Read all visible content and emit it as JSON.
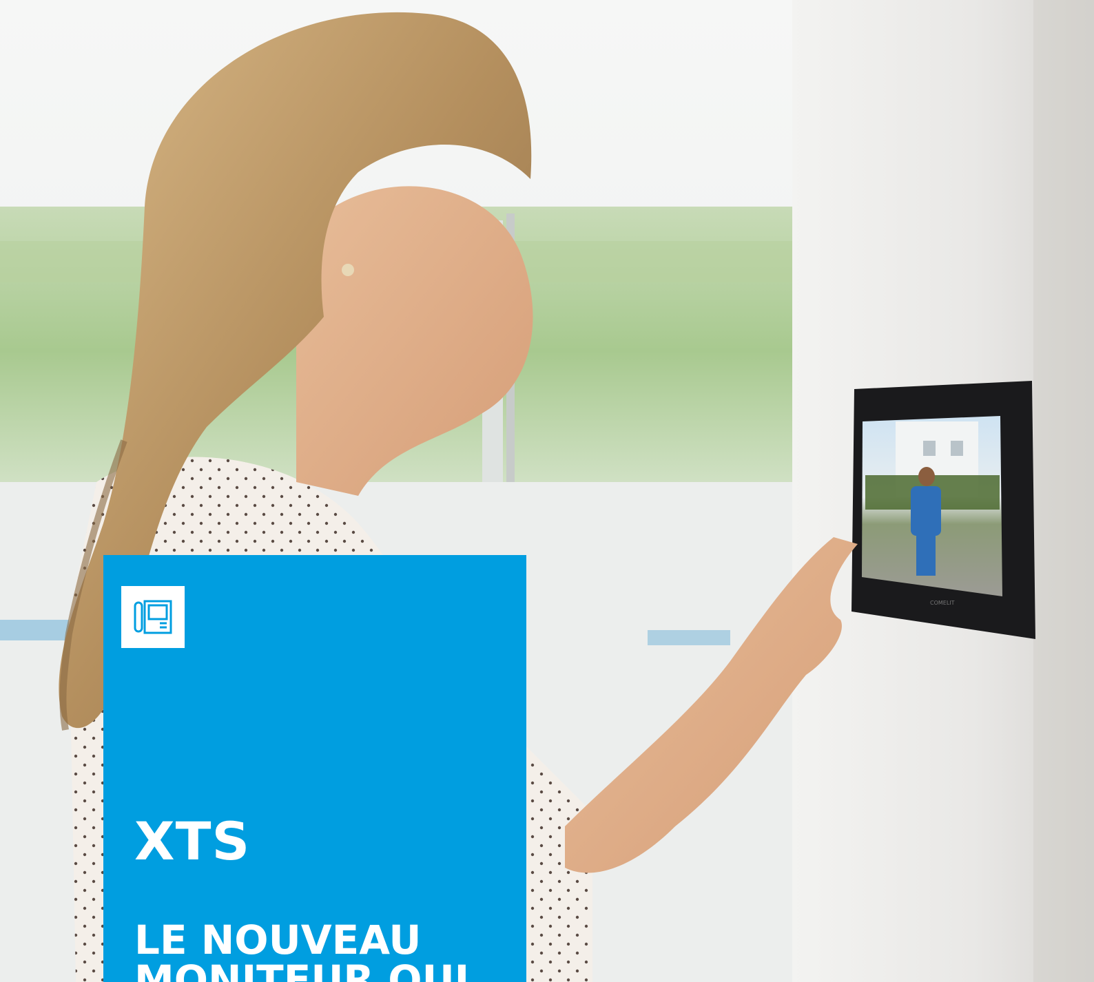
{
  "colors": {
    "brand_blue": "#009ee0",
    "icon_tile": "#ffffff",
    "text": "#ffffff"
  },
  "icons": {
    "product": "video-door-entry-icon"
  },
  "panel": {
    "title": "XTS",
    "headline_lines": [
      "LE NOUVEAU",
      "MONITEUR QUI"
    ]
  }
}
